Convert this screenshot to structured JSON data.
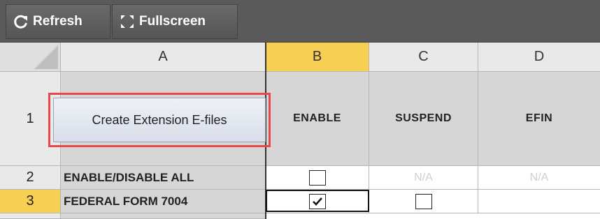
{
  "toolbar": {
    "refresh_label": "Refresh",
    "fullscreen_label": "Fullscreen",
    "refresh_icon": "refresh-icon",
    "fullscreen_icon": "fullscreen-icon"
  },
  "grid": {
    "columns": [
      "A",
      "B",
      "C",
      "D"
    ],
    "selected_column": "B",
    "rows": [
      "1",
      "2",
      "3"
    ],
    "selected_row": "3",
    "row1": {
      "a_button": "Create Extension E-files",
      "b": "ENABLE",
      "c": "SUSPEND",
      "d": "EFIN"
    },
    "row2": {
      "a": "ENABLE/DISABLE ALL",
      "b_checked": false,
      "c": "N/A",
      "d": "N/A"
    },
    "row3": {
      "a": "FEDERAL FORM 7004",
      "b_checked": true,
      "c_checked": false
    }
  },
  "colors": {
    "toolbar": "#5a5a5a",
    "selected_header": "#f7cf52",
    "highlight_box": "#e8474b"
  }
}
